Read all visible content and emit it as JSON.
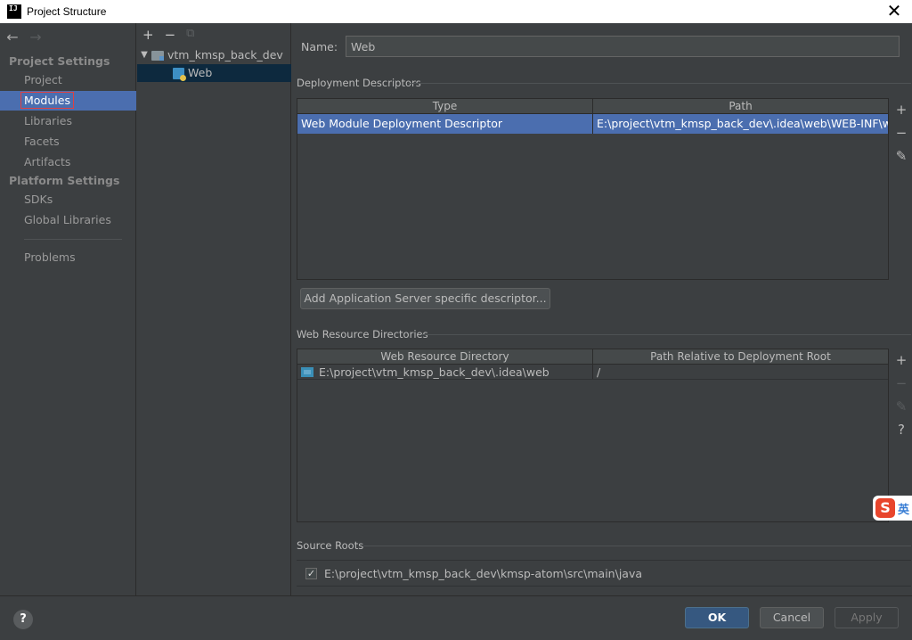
{
  "window": {
    "title": "Project Structure",
    "app_icon": "IJ",
    "close_icon": "close-icon"
  },
  "sidebar": {
    "back_icon": "←",
    "forward_icon": "→",
    "project_settings_header": "Project Settings",
    "project_items": [
      "Project",
      "Modules",
      "Libraries",
      "Facets",
      "Artifacts"
    ],
    "platform_settings_header": "Platform Settings",
    "platform_items": [
      "SDKs",
      "Global Libraries"
    ],
    "problems": "Problems",
    "selected": "Modules"
  },
  "tree": {
    "add_icon": "+",
    "remove_icon": "−",
    "copy_icon": "⧉",
    "root": "vtm_kmsp_back_dev",
    "child": "Web"
  },
  "main": {
    "name_label": "Name:",
    "name_value": "Web",
    "deployment": {
      "title": "Deployment Descriptors",
      "columns": [
        "Type",
        "Path"
      ],
      "rows": [
        {
          "type": "Web Module Deployment Descriptor",
          "path": "E:\\project\\vtm_kmsp_back_dev\\.idea\\web\\WEB-INF\\web.xml"
        }
      ],
      "add_button": "Add Application Server specific descriptor..."
    },
    "web_resources": {
      "title": "Web Resource Directories",
      "columns": [
        "Web Resource Directory",
        "Path Relative to Deployment Root"
      ],
      "rows": [
        {
          "dir": "E:\\project\\vtm_kmsp_back_dev\\.idea\\web",
          "relative": "/"
        }
      ]
    },
    "source_roots": {
      "title": "Source Roots",
      "checked": true,
      "path": "E:\\project\\vtm_kmsp_back_dev\\kmsp-atom\\src\\main\\java"
    },
    "side_tools": {
      "add": "+",
      "remove": "−",
      "edit": "✎",
      "help": "?"
    }
  },
  "footer": {
    "help": "?",
    "ok": "OK",
    "cancel": "Cancel",
    "apply": "Apply"
  },
  "ime": {
    "logo": "S",
    "text": "英"
  }
}
